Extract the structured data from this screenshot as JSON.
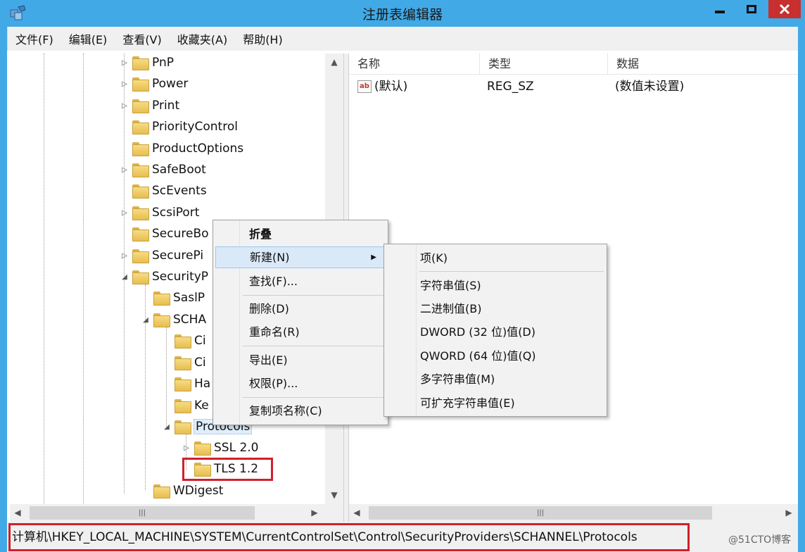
{
  "window": {
    "title": "注册表编辑器"
  },
  "menubar": [
    "文件(F)",
    "编辑(E)",
    "查看(V)",
    "收藏夹(A)",
    "帮助(H)"
  ],
  "tree": {
    "items": [
      {
        "label": "PnP",
        "expander": "▷"
      },
      {
        "label": "Power",
        "expander": "▷"
      },
      {
        "label": "Print",
        "expander": "▷"
      },
      {
        "label": "PriorityControl",
        "expander": ""
      },
      {
        "label": "ProductOptions",
        "expander": ""
      },
      {
        "label": "SafeBoot",
        "expander": "▷"
      },
      {
        "label": "ScEvents",
        "expander": ""
      },
      {
        "label": "ScsiPort",
        "expander": "▷"
      },
      {
        "label": "SecureBo",
        "expander": ""
      },
      {
        "label": "SecurePi",
        "expander": "▷"
      },
      {
        "label": "SecurityP",
        "expander": "◢"
      },
      {
        "label": "SaslP",
        "expander": ""
      },
      {
        "label": "SCHA",
        "expander": "◢"
      },
      {
        "label": "Ci",
        "expander": ""
      },
      {
        "label": "Ci",
        "expander": ""
      },
      {
        "label": "Ha",
        "expander": ""
      },
      {
        "label": "Ke",
        "expander": ""
      },
      {
        "label": "Protocols",
        "expander": "◢"
      },
      {
        "label": "SSL 2.0",
        "expander": "▷"
      },
      {
        "label": "TLS 1.2",
        "expander": ""
      },
      {
        "label": "WDigest",
        "expander": ""
      }
    ]
  },
  "list": {
    "columns": [
      "名称",
      "类型",
      "数据"
    ],
    "rows": [
      {
        "name": "(默认)",
        "type": "REG_SZ",
        "data": "(数值未设置)"
      }
    ],
    "ab_icon": "ab"
  },
  "context_menu": {
    "collapse": "折叠",
    "new": "新建(N)",
    "find": "查找(F)...",
    "delete": "删除(D)",
    "rename": "重命名(R)",
    "export": "导出(E)",
    "permissions": "权限(P)...",
    "copy_key_name": "复制项名称(C)"
  },
  "submenu": {
    "key": "项(K)",
    "string": "字符串值(S)",
    "binary": "二进制值(B)",
    "dword": "DWORD (32 位)值(D)",
    "qword": "QWORD (64 位)值(Q)",
    "multi_string": "多字符串值(M)",
    "expand_string": "可扩充字符串值(E)"
  },
  "statusbar": {
    "path": "计算机\\HKEY_LOCAL_MACHINE\\SYSTEM\\CurrentControlSet\\Control\\SecurityProviders\\SCHANNEL\\Protocols"
  },
  "watermark": "@51CTO博客",
  "colors": {
    "titlebar": "#41a9e6",
    "highlight_red": "#d21f2b",
    "close": "#c7302e"
  }
}
